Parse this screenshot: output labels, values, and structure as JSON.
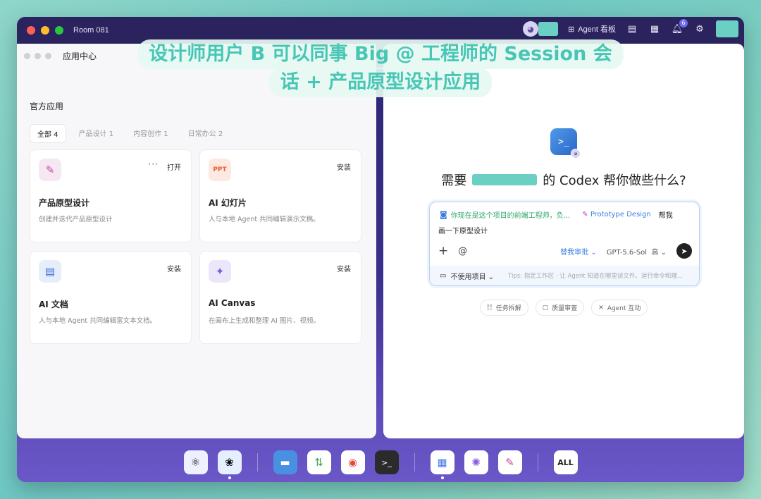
{
  "window": {
    "title": "Room 081",
    "agent_board": "Agent 看板",
    "notif_count": "6"
  },
  "caption": {
    "line1": "设计师用户 B 可以同事 Big @ 工程师的 Session 会",
    "line2": "话 + 产品原型设计应用"
  },
  "left_panel": {
    "title": "应用中心",
    "section": "官方应用",
    "tabs": [
      "全部 4",
      "产品设计 1",
      "内容创作 1",
      "日常办公 2"
    ],
    "cards": [
      {
        "name": "产品原型设计",
        "desc": "创建并迭代产品原型设计",
        "action": "打开",
        "more": "···",
        "icon": "pen-ruler-icon",
        "color": "#f3e4f1"
      },
      {
        "name": "AI 幻灯片",
        "desc": "人与本地 Agent 共同编辑演示文稿。",
        "action": "安装",
        "icon": "ppt-icon",
        "color": "#f26b3a"
      },
      {
        "name": "AI 文档",
        "desc": "人与本地 Agent 共同编辑富文本文档。",
        "action": "安装",
        "icon": "doc-icon",
        "color": "#3b6fd9"
      },
      {
        "name": "AI Canvas",
        "desc": "在画布上生成和整理 AI 图片、视频。",
        "action": "安装",
        "icon": "canvas-icon",
        "color": "#7b5ce0"
      }
    ]
  },
  "right_panel": {
    "ask_prefix": "需要",
    "ask_suffix": "的 Codex 帮你做些什么?",
    "composer": {
      "mention_agent": "你现在是这个项目的前端工程师，负...",
      "mention_app": "Prototype Design",
      "text_tail": "帮我",
      "text_line2": "画一下原型设计",
      "approve": "替我审批",
      "model": "GPT-5.6-Sol",
      "effort": "高",
      "project": "不使用项目",
      "tips": "Tips: 指定工作区 · 让 Agent 知道在哪里读文件、运行命令和理..."
    },
    "quick": [
      "任务拆解",
      "质量审查",
      "Agent 互动"
    ]
  },
  "dock": {
    "all_label": "ALL"
  }
}
